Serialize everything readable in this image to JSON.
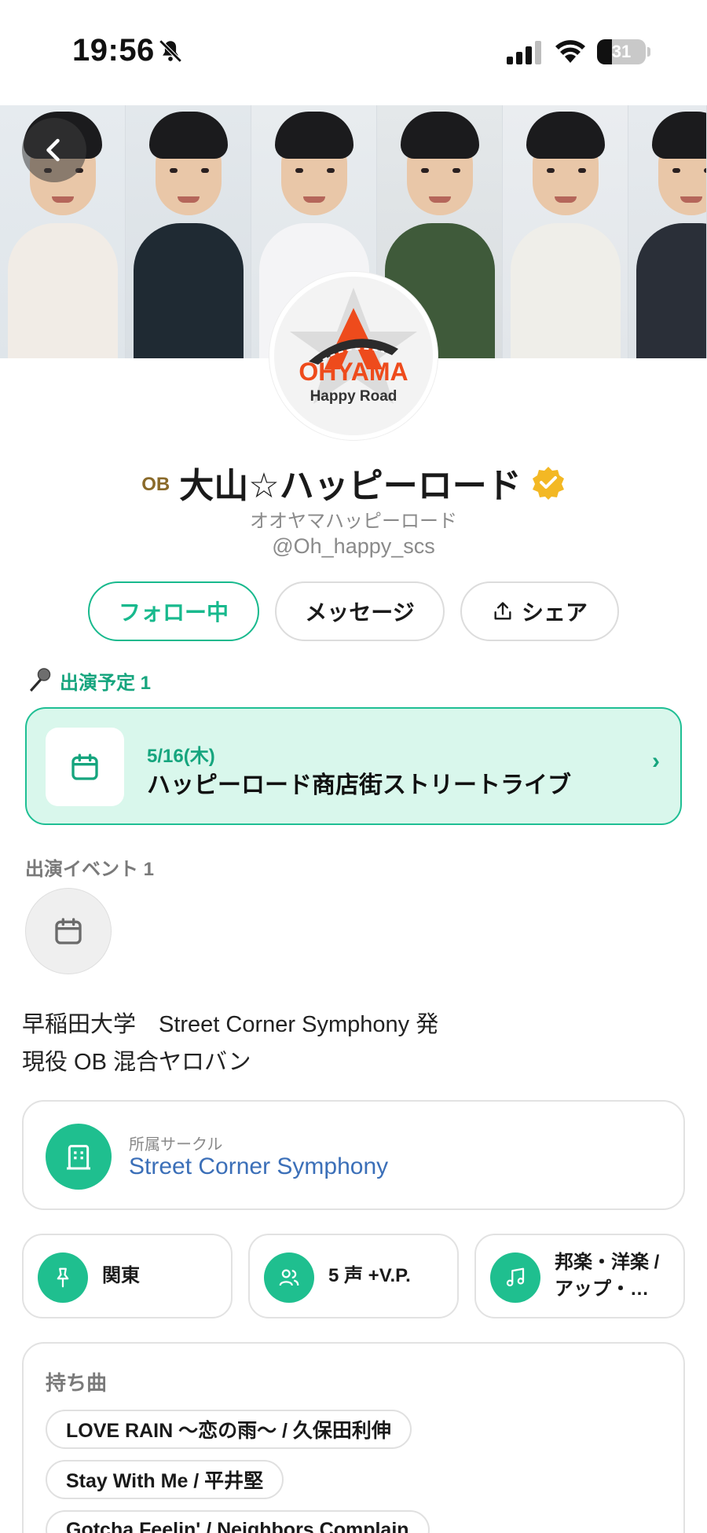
{
  "status_bar": {
    "time": "19:56",
    "battery": "31",
    "battery_level": 0.31
  },
  "header": {
    "back_icon": "chevron-left-icon",
    "logo_text": "OHYAMA",
    "logo_sub": "Happy Road"
  },
  "profile": {
    "badge": "OB",
    "name": "大山☆ハッピーロード",
    "reading": "オオヤマハッピーロード",
    "handle": "@Oh_happy_scs",
    "verified_icon": "verified-check-icon"
  },
  "actions": {
    "follow": "フォロー中",
    "message": "メッセージ",
    "share": "シェア"
  },
  "scheduled": {
    "heading": "出演予定 1",
    "event": {
      "date": "5/16(木)",
      "title": "ハッピーロード商店街ストリートライブ"
    }
  },
  "appearances": {
    "heading": "出演イベント 1"
  },
  "bio": {
    "line1": "早稲田大学　Street Corner Symphony 発",
    "line2": "現役 OB 混合ヤロバン"
  },
  "circle": {
    "label": "所属サークル",
    "name": "Street Corner Symphony"
  },
  "info": {
    "region": "関東",
    "voices": "5 声 +V.P.",
    "genre": "邦楽・洋楽 / アップ・…"
  },
  "songs": {
    "heading": "持ち曲",
    "items": [
      "LOVE RAIN 〜恋の雨〜 / 久保田利伸",
      "Stay With Me / 平井堅",
      "Gotcha Feelin' / Neighbors Complain"
    ]
  },
  "colors": {
    "accent": "#18b98d",
    "card_bg": "#d9f7ec",
    "link": "#3b6fb8"
  }
}
